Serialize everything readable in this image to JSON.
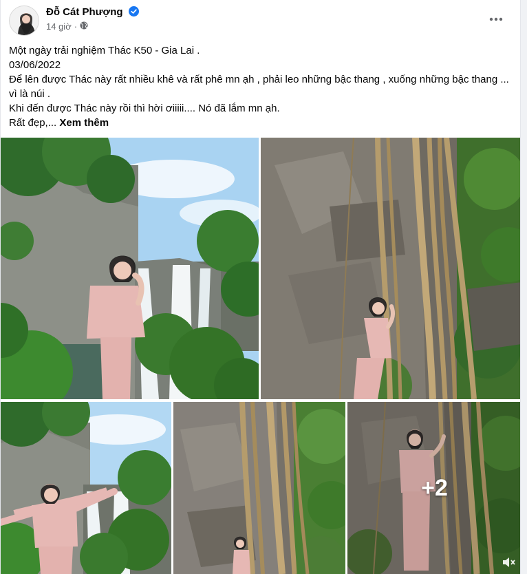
{
  "post": {
    "author": "Đỗ Cát Phượng",
    "time": "14 giờ",
    "lines": [
      "Một ngày trải nghiệm Thác K50 - Gia Lai .",
      "03/06/2022",
      "Để lên được Thác này rất nhiều khê và rất phê mn ạh , phải leo những bậc thang , xuống những bậc thang ... vì là núi .",
      "Khi đến được Thác này rồi thì hời ơiiiii.... Nó đã lắm mn ạh.",
      "Rất đẹp,..."
    ],
    "see_more": "Xem thêm"
  },
  "photos": {
    "more_count": "+2"
  },
  "icons": [
    "verified-badge-icon",
    "globe-icon",
    "more-options-icon",
    "speaker-muted-icon"
  ],
  "colors": {
    "verified": "#1877f2",
    "secondary_text": "#65676b",
    "outfit": "#e6b8b4"
  }
}
